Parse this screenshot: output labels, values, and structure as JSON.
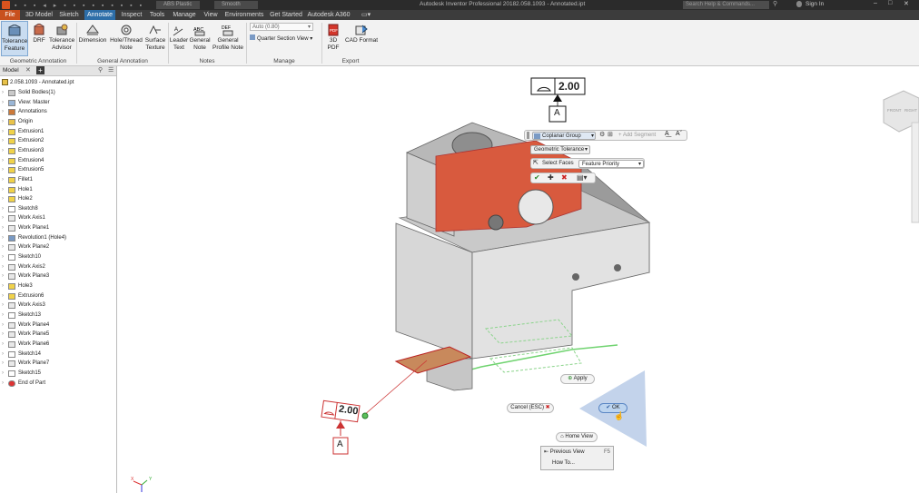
{
  "titlebar": {
    "app_title": "Autodesk Inventor Professional 2018",
    "file_title": "2.058.1093 - Annotated.ipt",
    "material": "ABS Plastic",
    "appearance": "Smooth",
    "search_placeholder": "Search Help & Commands...",
    "sign_in": "Sign In"
  },
  "tabs": [
    "File",
    "3D Model",
    "Sketch",
    "Annotate",
    "Inspect",
    "Tools",
    "Manage",
    "View",
    "Environments",
    "Get Started",
    "Autodesk A360"
  ],
  "active_tab": "Annotate",
  "ribbon": {
    "tolerance_feature": "Tolerance Feature",
    "drf": "DRF",
    "tolerance_advisor": "Tolerance Advisor",
    "dimension": "Dimension",
    "hole_thread_note": "Hole/Thread Note",
    "surface_texture": "Surface Texture",
    "leader_text": "Leader Text",
    "general_note": "General Note",
    "general_profile_note": "General Profile Note",
    "scale_value": "Auto (0.80)",
    "section_view": "Quarter Section View",
    "pdf_3d": "3D PDF",
    "cad_format": "CAD Format",
    "group_geometric": "Geometric Annotation",
    "group_general": "General Annotation",
    "group_notes": "Notes",
    "group_manage": "Manage",
    "group_export": "Export"
  },
  "browser": {
    "tab_model": "Model",
    "root": "2.058.1093 - Annotated.ipt",
    "nodes": [
      "Solid Bodies(1)",
      "View: Master",
      "Annotations",
      "Origin",
      "Extrusion1",
      "Extrusion2",
      "Extrusion3",
      "Extrusion4",
      "Extrusion5",
      "Fillet1",
      "Hole1",
      "Hole2",
      "Sketch8",
      "Work Axis1",
      "Work Plane1",
      "Revolution1 (Hole4)",
      "Work Plane2",
      "Sketch10",
      "Work Axis2",
      "Work Plane3",
      "Hole3",
      "Extrusion6",
      "Work Axis3",
      "Sketch13",
      "Work Plane4",
      "Work Plane5",
      "Work Plane6",
      "Sketch14",
      "Work Plane7",
      "Sketch15",
      "End of Part"
    ]
  },
  "viewport": {
    "tolerance_value_top": "2.00",
    "datum_top": "A",
    "tolerance_value_left": "2.00",
    "datum_left": "A",
    "coplanar_group": "Coplanar Group",
    "add_segment": "Add Segment",
    "geometric_tolerance": "Geometric Tolerance",
    "select_faces": "Select Faces",
    "feature_priority": "Feature Priority",
    "apply": "Apply",
    "cancel": "Cancel (ESC)",
    "ok": "OK",
    "home_view": "Home View",
    "previous_view": "Previous View",
    "previous_shortcut": "F5",
    "how_to": "How To...",
    "viewcube_front": "FRONT",
    "viewcube_right": "RIGHT",
    "axis_x": "X",
    "axis_y": "Y"
  },
  "colors": {
    "active_tab": "#2d6ea8",
    "file_tab": "#c8501e",
    "selected_face": "#d85a3e",
    "body": "#dedede",
    "ok_button": "#bcd4ef"
  },
  "icons": [
    "tolerance-feature-icon",
    "drf-icon",
    "tolerance-advisor-icon",
    "dimension-icon",
    "hole-thread-note-icon",
    "surface-texture-icon",
    "leader-text-icon",
    "general-note-icon",
    "general-profile-note-icon",
    "3d-pdf-icon",
    "cad-format-icon",
    "check-icon",
    "plus-icon",
    "close-icon"
  ]
}
